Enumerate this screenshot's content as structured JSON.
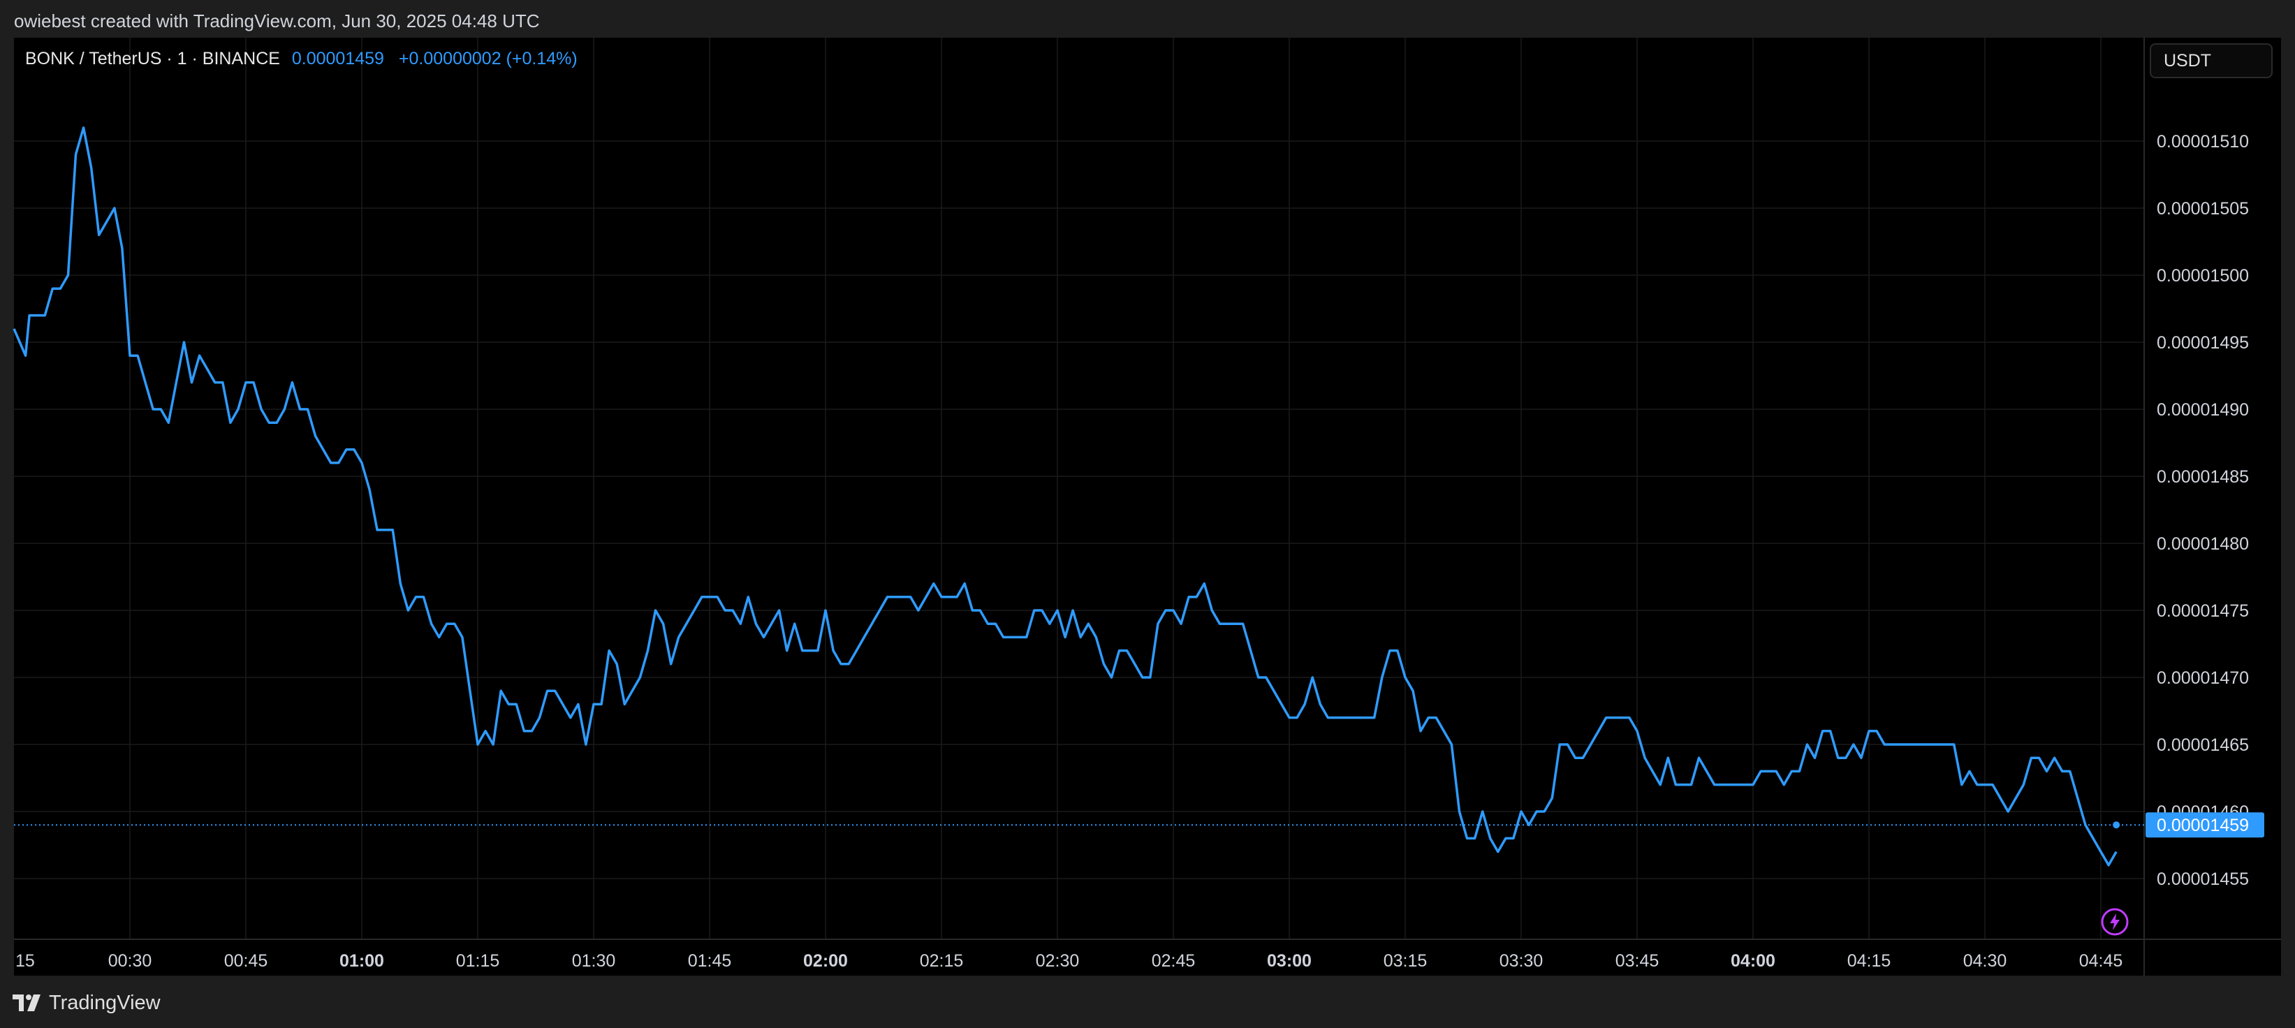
{
  "header": {
    "attribution": "owiebest created with TradingView.com, Jun 30, 2025 04:48 UTC"
  },
  "legend": {
    "symbol": "BONK / TetherUS · 1 · BINANCE",
    "last_price": "0.00001459",
    "change": "+0.00000002 (+0.14%)"
  },
  "currency_button": {
    "label": "USDT"
  },
  "footer": {
    "brand": "TradingView"
  },
  "icons": {
    "flash": "lightning-icon",
    "logo": "tradingview-logo-icon"
  },
  "colors": {
    "line": "#2f9bff",
    "background": "#000000",
    "grid": "#1a1a1a",
    "accent_label": "#2f9bff",
    "flash_icon": "#c03cff"
  },
  "chart_data": {
    "type": "line",
    "x_unit": "minutes after 00:15 UTC",
    "ylim": [
      1.45e-05,
      1.516e-05
    ],
    "xlim": [
      15,
      303
    ],
    "y_ticks": [
      "0.00001455",
      "0.00001460",
      "0.00001465",
      "0.00001470",
      "0.00001475",
      "0.00001480",
      "0.00001485",
      "0.00001490",
      "0.00001495",
      "0.00001500",
      "0.00001505",
      "0.00001510"
    ],
    "x_ticks": [
      {
        "label": "15",
        "t": 15,
        "bold": false
      },
      {
        "label": "00:30",
        "t": 30,
        "bold": false
      },
      {
        "label": "00:45",
        "t": 45,
        "bold": false
      },
      {
        "label": "01:00",
        "t": 60,
        "bold": true
      },
      {
        "label": "01:15",
        "t": 75,
        "bold": false
      },
      {
        "label": "01:30",
        "t": 90,
        "bold": false
      },
      {
        "label": "01:45",
        "t": 105,
        "bold": false
      },
      {
        "label": "02:00",
        "t": 120,
        "bold": true
      },
      {
        "label": "02:15",
        "t": 135,
        "bold": false
      },
      {
        "label": "02:30",
        "t": 150,
        "bold": false
      },
      {
        "label": "02:45",
        "t": 165,
        "bold": false
      },
      {
        "label": "03:00",
        "t": 180,
        "bold": true
      },
      {
        "label": "03:15",
        "t": 195,
        "bold": false
      },
      {
        "label": "03:30",
        "t": 210,
        "bold": false
      },
      {
        "label": "03:45",
        "t": 225,
        "bold": false
      },
      {
        "label": "04:00",
        "t": 240,
        "bold": true
      },
      {
        "label": "04:15",
        "t": 255,
        "bold": false
      },
      {
        "label": "04:30",
        "t": 270,
        "bold": false
      },
      {
        "label": "04:45",
        "t": 285,
        "bold": false
      }
    ],
    "last_value_label": "0.00001459",
    "last_value": 1.459e-05,
    "x": [
      15,
      16.5,
      17,
      18,
      19,
      20,
      21,
      22,
      23,
      24,
      25,
      26,
      27,
      28,
      29,
      30,
      31,
      32,
      33,
      34,
      35,
      36,
      37,
      38,
      39,
      40,
      41,
      42,
      43,
      44,
      45,
      46,
      47,
      48,
      49,
      50,
      51,
      52,
      53,
      54,
      55,
      56,
      57,
      58,
      59,
      60,
      61,
      62,
      63,
      64,
      65,
      66,
      67,
      68,
      69,
      70,
      71,
      72,
      73,
      74,
      75,
      76,
      77,
      78,
      79,
      80,
      81,
      82,
      83,
      84,
      85,
      86,
      87,
      88,
      89,
      90,
      91,
      92,
      93,
      94,
      95,
      96,
      97,
      98,
      99,
      100,
      101,
      102,
      103,
      104,
      105,
      106,
      107,
      108,
      109,
      110,
      111,
      112,
      113,
      114,
      115,
      116,
      117,
      118,
      119,
      120,
      121,
      122,
      123,
      124,
      125,
      126,
      127,
      128,
      129,
      130,
      131,
      132,
      133,
      134,
      135,
      136,
      137,
      138,
      139,
      140,
      141,
      142,
      143,
      144,
      145,
      146,
      147,
      148,
      149,
      150,
      151,
      152,
      153,
      154,
      155,
      156,
      157,
      158,
      159,
      160,
      161,
      162,
      163,
      164,
      165,
      166,
      167,
      168,
      169,
      170,
      171,
      172,
      173,
      174,
      175,
      176,
      177,
      178,
      179,
      180,
      181,
      182,
      183,
      184,
      185,
      186,
      187,
      188,
      189,
      190,
      191,
      192,
      193,
      194,
      195,
      196,
      197,
      198,
      199,
      200,
      201,
      202,
      203,
      204,
      205,
      206,
      207,
      208,
      209,
      210,
      211,
      212,
      213,
      214,
      215,
      216,
      217,
      218,
      219,
      220,
      221,
      222,
      223,
      224,
      225,
      226,
      227,
      228,
      229,
      230,
      231,
      232,
      233,
      234,
      235,
      236,
      237,
      238,
      239,
      240,
      241,
      242,
      243,
      244,
      245,
      246,
      247,
      248,
      249,
      250,
      251,
      252,
      253,
      254,
      255,
      256,
      257,
      258,
      259,
      260,
      261,
      262,
      263,
      264,
      265,
      266,
      267,
      268,
      269,
      270,
      271,
      272,
      273,
      274,
      275,
      276,
      277,
      278,
      279,
      280,
      281,
      282,
      283,
      284,
      285,
      286,
      287
    ],
    "y": [
      1.496e-05,
      1.494e-05,
      1.497e-05,
      1.497e-05,
      1.497e-05,
      1.499e-05,
      1.499e-05,
      1.5e-05,
      1.509e-05,
      1.511e-05,
      1.508e-05,
      1.503e-05,
      1.504e-05,
      1.505e-05,
      1.502e-05,
      1.494e-05,
      1.494e-05,
      1.492e-05,
      1.49e-05,
      1.49e-05,
      1.489e-05,
      1.492e-05,
      1.495e-05,
      1.492e-05,
      1.494e-05,
      1.493e-05,
      1.492e-05,
      1.492e-05,
      1.489e-05,
      1.49e-05,
      1.492e-05,
      1.492e-05,
      1.49e-05,
      1.489e-05,
      1.489e-05,
      1.49e-05,
      1.492e-05,
      1.49e-05,
      1.49e-05,
      1.488e-05,
      1.487e-05,
      1.486e-05,
      1.486e-05,
      1.487e-05,
      1.487e-05,
      1.486e-05,
      1.484e-05,
      1.481e-05,
      1.481e-05,
      1.481e-05,
      1.477e-05,
      1.475e-05,
      1.476e-05,
      1.476e-05,
      1.474e-05,
      1.473e-05,
      1.474e-05,
      1.474e-05,
      1.473e-05,
      1.469e-05,
      1.465e-05,
      1.466e-05,
      1.465e-05,
      1.469e-05,
      1.468e-05,
      1.468e-05,
      1.466e-05,
      1.466e-05,
      1.467e-05,
      1.469e-05,
      1.469e-05,
      1.468e-05,
      1.467e-05,
      1.468e-05,
      1.465e-05,
      1.468e-05,
      1.468e-05,
      1.472e-05,
      1.471e-05,
      1.468e-05,
      1.469e-05,
      1.47e-05,
      1.472e-05,
      1.475e-05,
      1.474e-05,
      1.471e-05,
      1.473e-05,
      1.474e-05,
      1.475e-05,
      1.476e-05,
      1.476e-05,
      1.476e-05,
      1.475e-05,
      1.475e-05,
      1.474e-05,
      1.476e-05,
      1.474e-05,
      1.473e-05,
      1.474e-05,
      1.475e-05,
      1.472e-05,
      1.474e-05,
      1.472e-05,
      1.472e-05,
      1.472e-05,
      1.475e-05,
      1.472e-05,
      1.471e-05,
      1.471e-05,
      1.472e-05,
      1.473e-05,
      1.474e-05,
      1.475e-05,
      1.476e-05,
      1.476e-05,
      1.476e-05,
      1.476e-05,
      1.475e-05,
      1.476e-05,
      1.477e-05,
      1.476e-05,
      1.476e-05,
      1.476e-05,
      1.477e-05,
      1.475e-05,
      1.475e-05,
      1.474e-05,
      1.474e-05,
      1.473e-05,
      1.473e-05,
      1.473e-05,
      1.473e-05,
      1.475e-05,
      1.475e-05,
      1.474e-05,
      1.475e-05,
      1.473e-05,
      1.475e-05,
      1.473e-05,
      1.474e-05,
      1.473e-05,
      1.471e-05,
      1.47e-05,
      1.472e-05,
      1.472e-05,
      1.471e-05,
      1.47e-05,
      1.47e-05,
      1.474e-05,
      1.475e-05,
      1.475e-05,
      1.474e-05,
      1.476e-05,
      1.476e-05,
      1.477e-05,
      1.475e-05,
      1.474e-05,
      1.474e-05,
      1.474e-05,
      1.474e-05,
      1.472e-05,
      1.47e-05,
      1.47e-05,
      1.469e-05,
      1.468e-05,
      1.467e-05,
      1.467e-05,
      1.468e-05,
      1.47e-05,
      1.468e-05,
      1.467e-05,
      1.467e-05,
      1.467e-05,
      1.467e-05,
      1.467e-05,
      1.467e-05,
      1.467e-05,
      1.47e-05,
      1.472e-05,
      1.472e-05,
      1.47e-05,
      1.469e-05,
      1.466e-05,
      1.467e-05,
      1.467e-05,
      1.466e-05,
      1.465e-05,
      1.46e-05,
      1.458e-05,
      1.458e-05,
      1.46e-05,
      1.458e-05,
      1.457e-05,
      1.458e-05,
      1.458e-05,
      1.46e-05,
      1.459e-05,
      1.46e-05,
      1.46e-05,
      1.461e-05,
      1.465e-05,
      1.465e-05,
      1.464e-05,
      1.464e-05,
      1.465e-05,
      1.466e-05,
      1.467e-05,
      1.467e-05,
      1.467e-05,
      1.467e-05,
      1.466e-05,
      1.464e-05,
      1.463e-05,
      1.462e-05,
      1.464e-05,
      1.462e-05,
      1.462e-05,
      1.462e-05,
      1.464e-05,
      1.463e-05,
      1.462e-05,
      1.462e-05,
      1.462e-05,
      1.462e-05,
      1.462e-05,
      1.462e-05,
      1.463e-05,
      1.463e-05,
      1.463e-05,
      1.462e-05,
      1.463e-05,
      1.463e-05,
      1.465e-05,
      1.464e-05,
      1.466e-05,
      1.466e-05,
      1.464e-05,
      1.464e-05,
      1.465e-05,
      1.464e-05,
      1.466e-05,
      1.466e-05,
      1.465e-05,
      1.465e-05,
      1.465e-05,
      1.465e-05,
      1.465e-05,
      1.465e-05,
      1.465e-05,
      1.465e-05,
      1.465e-05,
      1.465e-05,
      1.462e-05,
      1.463e-05,
      1.462e-05,
      1.462e-05,
      1.462e-05,
      1.461e-05,
      1.46e-05,
      1.461e-05,
      1.462e-05,
      1.464e-05,
      1.464e-05,
      1.463e-05,
      1.464e-05,
      1.463e-05,
      1.463e-05,
      1.461e-05,
      1.459e-05,
      1.458e-05,
      1.457e-05,
      1.456e-05,
      1.457e-05,
      1.457e-05,
      1.459e-05
    ]
  }
}
